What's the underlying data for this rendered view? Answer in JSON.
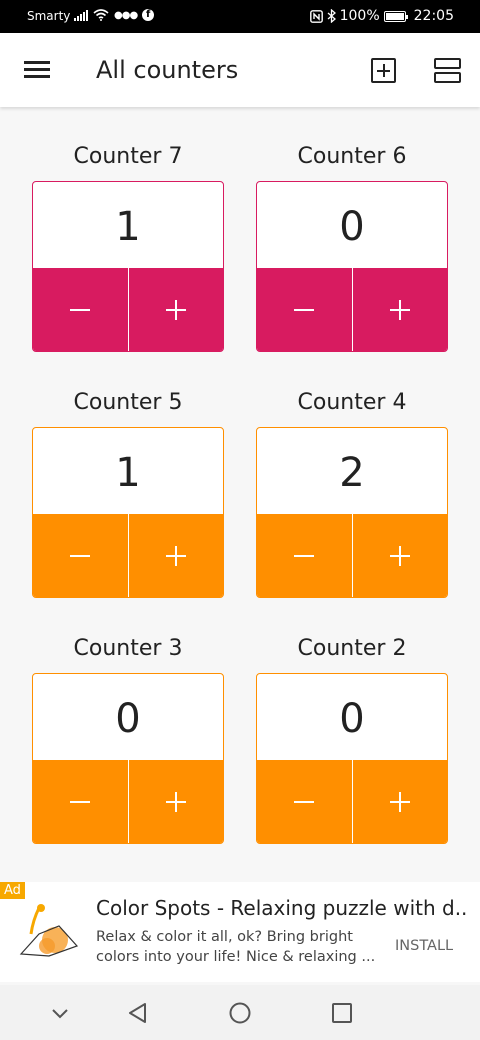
{
  "status_bar": {
    "carrier": "Smarty",
    "battery": "100%",
    "time": "22:05"
  },
  "app_bar": {
    "title": "All counters"
  },
  "colors": {
    "pink": "#d81b60",
    "orange": "#ff8f00"
  },
  "counters": [
    {
      "name": "Counter 7",
      "value": "1",
      "minus": "−",
      "plus": "+",
      "color": "pink"
    },
    {
      "name": "Counter 6",
      "value": "0",
      "minus": "−",
      "plus": "+",
      "color": "pink"
    },
    {
      "name": "Counter 5",
      "value": "1",
      "minus": "−",
      "plus": "+",
      "color": "orange"
    },
    {
      "name": "Counter 4",
      "value": "2",
      "minus": "−",
      "plus": "+",
      "color": "orange"
    },
    {
      "name": "Counter 3",
      "value": "0",
      "minus": "−",
      "plus": "+",
      "color": "orange"
    },
    {
      "name": "Counter 2",
      "value": "0",
      "minus": "−",
      "plus": "+",
      "color": "orange"
    }
  ],
  "ad": {
    "badge": "Ad",
    "title": "Color Spots - Relaxing puzzle with d...",
    "description": "Relax & color it all, ok? Bring bright colors into your life! Nice & relaxing ...",
    "install": "INSTALL"
  },
  "nav_bar": {
    "icons": [
      "chevron-down-icon",
      "back-icon",
      "home-icon",
      "recents-icon"
    ]
  }
}
